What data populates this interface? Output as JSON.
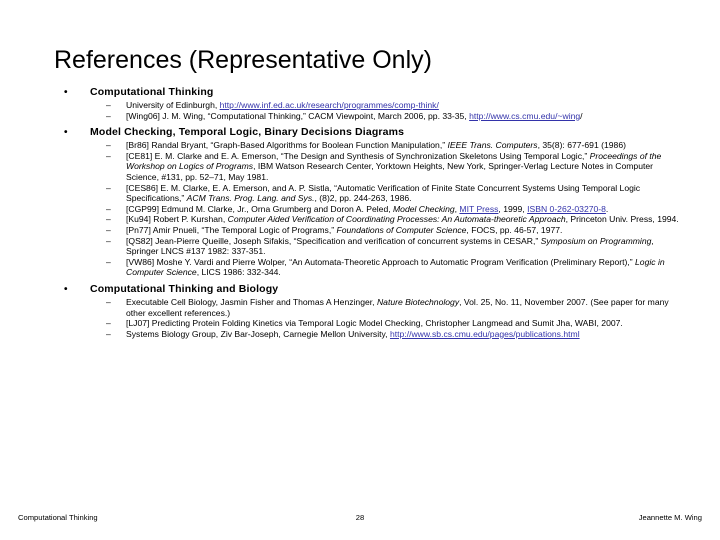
{
  "slide": {
    "title": "References (Representative Only)",
    "bullet_glyph": "•",
    "dash_glyph": "–",
    "link_color": "#3333AA",
    "text_color": "#000000",
    "background_color": "#FFFFFF"
  },
  "sections": [
    {
      "heading": "Computational Thinking",
      "items": [
        {
          "parts": [
            {
              "type": "text",
              "text": "University of Edinburgh, "
            },
            {
              "type": "link",
              "text": "http://www.inf.ed.ac.uk/research/programmes/comp-think/"
            }
          ]
        },
        {
          "parts": [
            {
              "type": "text",
              "text": "[Wing06] J. M. Wing, “Computational Thinking,” CACM Viewpoint, March 2006, pp. 33-35, "
            },
            {
              "type": "link",
              "text": "http://www.cs.cmu.edu/~wing"
            },
            {
              "type": "text",
              "text": "/"
            }
          ]
        }
      ]
    },
    {
      "heading": "Model Checking, Temporal Logic, Binary Decisions Diagrams",
      "items": [
        {
          "parts": [
            {
              "type": "text",
              "text": "[Br86] Randal Bryant, “Graph-Based Algorithms for Boolean Function Manipulation,” "
            },
            {
              "type": "italic",
              "text": "IEEE Trans. Computers"
            },
            {
              "type": "text",
              "text": ", 35(8): 677-691 (1986)"
            }
          ]
        },
        {
          "parts": [
            {
              "type": "text",
              "text": "[CE81] E. M. Clarke and E. A. Emerson, “The Design and Synthesis of Synchronization Skeletons Using Temporal Logic,” "
            },
            {
              "type": "italic",
              "text": "Proceedings of the Workshop on Logics of Programs"
            },
            {
              "type": "text",
              "text": ", IBM Watson Research Center, Yorktown Heights, New York, Springer-Verlag Lecture Notes in Computer Science, #131, pp. 52–71, May 1981."
            }
          ]
        },
        {
          "parts": [
            {
              "type": "text",
              "text": "[CES86] E. M. Clarke, E. A. Emerson, and A. P. Sistla, “Automatic Verification of Finite State Concurrent Systems Using Temporal Logic Specifications,” "
            },
            {
              "type": "italic",
              "text": "ACM Trans. Prog. Lang. and Sys."
            },
            {
              "type": "text",
              "text": ", (8)2, pp. 244-263, 1986."
            }
          ]
        },
        {
          "parts": [
            {
              "type": "text",
              "text": "[CGP99] Edmund M. Clarke, Jr., Orna Grumberg and Doron A. Peled, "
            },
            {
              "type": "italic",
              "text": "Model Checking"
            },
            {
              "type": "text",
              "text": ", "
            },
            {
              "type": "link",
              "text": "MIT Press"
            },
            {
              "type": "text",
              "text": ", 1999, "
            },
            {
              "type": "link",
              "text": "ISBN 0-262-03270-8"
            },
            {
              "type": "text",
              "text": "."
            }
          ]
        },
        {
          "parts": [
            {
              "type": "text",
              "text": "[Ku94] Robert P. Kurshan, "
            },
            {
              "type": "italic",
              "text": "Computer Aided Verification of Coordinating Processes: An Automata-theoretic Approach"
            },
            {
              "type": "text",
              "text": ", Princeton Univ. Press, 1994."
            }
          ]
        },
        {
          "parts": [
            {
              "type": "text",
              "text": "[Pn77] Amir Pnueli, “The Temporal Logic of Programs,” "
            },
            {
              "type": "italic",
              "text": "Foundations of Computer Science"
            },
            {
              "type": "text",
              "text": ", FOCS, pp. 46-57, 1977."
            }
          ]
        },
        {
          "parts": [
            {
              "type": "text",
              "text": "[QS82] Jean-Pierre Queille, Joseph Sifakis, “Specification and verification of concurrent systems in CESAR,” "
            },
            {
              "type": "italic",
              "text": "Symposium on Programming"
            },
            {
              "type": "text",
              "text": ", Springer LNCS #137 1982: 337-351."
            }
          ]
        },
        {
          "parts": [
            {
              "type": "text",
              "text": "[VW86] Moshe Y. Vardi and Pierre Wolper, “An Automata-Theoretic Approach to Automatic Program Verification (Preliminary Report),” "
            },
            {
              "type": "italic",
              "text": "Logic in Computer Science"
            },
            {
              "type": "text",
              "text": ", LICS 1986: 332-344."
            }
          ]
        }
      ]
    },
    {
      "heading": "Computational Thinking and Biology",
      "items": [
        {
          "parts": [
            {
              "type": "text",
              "text": "Executable Cell Biology, Jasmin Fisher and Thomas A Henzinger, "
            },
            {
              "type": "italic",
              "text": "Nature Biotechnology"
            },
            {
              "type": "text",
              "text": ", Vol. 25, No. 11, November 2007. (See paper for many other excellent references.)"
            }
          ]
        },
        {
          "parts": [
            {
              "type": "text",
              "text": "[LJ07] Predicting Protein Folding Kinetics via Temporal Logic Model Checking, Christopher Langmead and Sumit Jha, WABI, 2007."
            }
          ]
        },
        {
          "parts": [
            {
              "type": "text",
              "text": "Systems Biology Group, Ziv Bar-Joseph, Carnegie Mellon University, "
            },
            {
              "type": "link",
              "text": "http://www.sb.cs.cmu.edu/pages/publications.html"
            }
          ]
        }
      ]
    }
  ],
  "footer": {
    "left": "Computational Thinking",
    "page_number": "28",
    "right": "Jeannette M. Wing"
  }
}
